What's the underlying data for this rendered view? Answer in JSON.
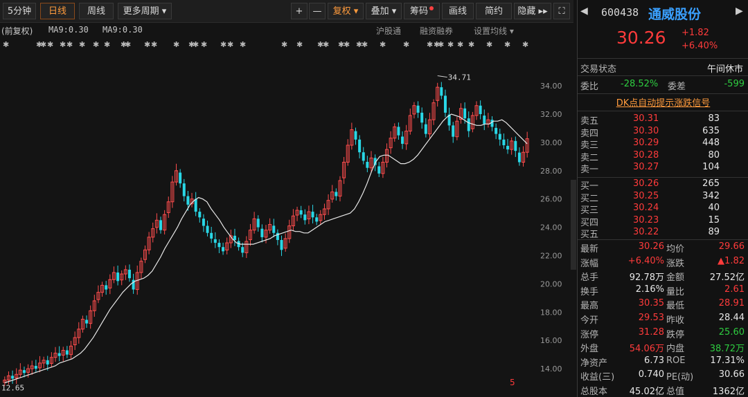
{
  "toolbar": {
    "tabs": [
      "5分钟",
      "日线",
      "周线",
      "更多周期 ▾"
    ],
    "active_tab": "日线",
    "tools": [
      "+",
      "—",
      "复权 ▾",
      "叠加 ▾",
      "筹码",
      "画线",
      "简约",
      "隐藏 ▸▸",
      "⛶"
    ]
  },
  "info": {
    "adjust": "(前复权)",
    "ma1": "MA9:0.30",
    "ma2": "MA9:0.30",
    "link1": "沪股通",
    "link2": "融资融券",
    "link3": "设置均线 ▾"
  },
  "chart_data": {
    "type": "candlestick",
    "ylim": [
      12.0,
      36.4
    ],
    "yticks": [
      "34.00",
      "32.00",
      "30.00",
      "28.00",
      "26.00",
      "24.00",
      "22.00",
      "20.00",
      "18.00",
      "16.00",
      "14.00"
    ],
    "yticks_values": [
      34,
      32,
      30,
      28,
      26,
      24,
      22,
      20,
      18,
      16,
      14
    ],
    "high_label": "34.71",
    "low_label": "12.65",
    "marker": "5",
    "up_color": "#ff4d4d",
    "down_color": "#29d7e6",
    "ma_color": "#e8e8e8",
    "closes": [
      13.2,
      13.5,
      13.3,
      13.6,
      13.9,
      13.7,
      14.0,
      14.2,
      14.0,
      14.4,
      14.6,
      14.3,
      14.8,
      15.1,
      14.9,
      15.3,
      15.0,
      15.6,
      16.2,
      16.8,
      17.5,
      17.2,
      18.1,
      18.8,
      19.4,
      19.9,
      19.6,
      20.3,
      20.8,
      20.2,
      20.7,
      21.0,
      20.4,
      19.6,
      20.8,
      21.6,
      22.4,
      23.3,
      23.9,
      24.5,
      23.8,
      24.9,
      25.8,
      27.2,
      28.0,
      27.1,
      26.2,
      25.6,
      26.0,
      25.1,
      24.7,
      24.1,
      23.6,
      23.2,
      22.9,
      22.6,
      22.3,
      22.9,
      23.4,
      23.1,
      22.6,
      22.2,
      23.0,
      23.8,
      24.6,
      24.0,
      23.3,
      23.8,
      24.2,
      23.6,
      23.1,
      22.4,
      23.2,
      24.1,
      24.8,
      25.2,
      24.9,
      24.5,
      25.1,
      24.7,
      24.4,
      24.9,
      25.3,
      25.9,
      26.5,
      26.2,
      27.3,
      28.6,
      29.8,
      30.9,
      30.2,
      29.3,
      28.7,
      28.2,
      28.9,
      28.4,
      27.8,
      28.6,
      29.5,
      30.3,
      31.1,
      30.5,
      29.9,
      30.8,
      31.9,
      32.6,
      32.1,
      31.4,
      30.6,
      31.6,
      32.8,
      33.9,
      33.3,
      32.1,
      31.2,
      30.4,
      31.5,
      32.4,
      31.7,
      30.8,
      31.9,
      32.6,
      32.0,
      31.3,
      31.6,
      31.1,
      30.6,
      30.2,
      29.8,
      29.5,
      30.1,
      29.4,
      28.6,
      29.3,
      30.26
    ],
    "ma": [
      13.0,
      13.1,
      13.2,
      13.3,
      13.4,
      13.5,
      13.6,
      13.7,
      13.8,
      13.9,
      14.0,
      14.1,
      14.2,
      14.4,
      14.5,
      14.6,
      14.7,
      14.9,
      15.1,
      15.4,
      15.8,
      16.2,
      16.7,
      17.2,
      17.7,
      18.2,
      18.6,
      19.0,
      19.4,
      19.7,
      20.0,
      20.2,
      20.3,
      20.4,
      20.6,
      20.9,
      21.4,
      21.9,
      22.5,
      23.0,
      23.5,
      24.0,
      24.6,
      25.1,
      25.6,
      25.9,
      26.1,
      26.0,
      25.8,
      25.3,
      24.9,
      24.5,
      24.0,
      23.6,
      23.2,
      22.9,
      22.8,
      22.8,
      22.8,
      22.8,
      22.9,
      23.0,
      23.1,
      23.2,
      23.4,
      23.5,
      23.6,
      23.7,
      23.8,
      23.7,
      23.7,
      23.6,
      23.6,
      23.8,
      24.0,
      24.2,
      24.4,
      24.5,
      24.6,
      24.7,
      24.8,
      24.9,
      25.0,
      25.3,
      25.8,
      26.4,
      27.1,
      27.9,
      28.6,
      29.0,
      29.1,
      29.1,
      28.9,
      28.7,
      28.5,
      28.5,
      28.6,
      28.8,
      29.1,
      29.5,
      29.9,
      30.3,
      30.7,
      31.1,
      31.5,
      31.8,
      32.0,
      31.9,
      31.8,
      31.6,
      31.4,
      31.3,
      31.2,
      31.2,
      31.3,
      31.3,
      31.5,
      31.5,
      31.6,
      31.4,
      31.1,
      30.8,
      30.5,
      30.2,
      29.9
    ]
  },
  "panel": {
    "code": "600438",
    "name": "通威股份",
    "price": "30.26",
    "change": "+1.82",
    "change_pct": "+6.40%",
    "status_label": "交易状态",
    "status_value": "午间休市",
    "wb_label": "委比",
    "wb_value": "-28.52%",
    "wc_label": "委差",
    "wc_value": "-599",
    "banner": "DK点自动提示涨跌信号",
    "asks": [
      {
        "label": "卖五",
        "price": "30.31",
        "vol": "83"
      },
      {
        "label": "卖四",
        "price": "30.30",
        "vol": "635"
      },
      {
        "label": "卖三",
        "price": "30.29",
        "vol": "448"
      },
      {
        "label": "卖二",
        "price": "30.28",
        "vol": "80"
      },
      {
        "label": "卖一",
        "price": "30.27",
        "vol": "104"
      }
    ],
    "bids": [
      {
        "label": "买一",
        "price": "30.26",
        "vol": "265"
      },
      {
        "label": "买二",
        "price": "30.25",
        "vol": "342"
      },
      {
        "label": "买三",
        "price": "30.24",
        "vol": "40"
      },
      {
        "label": "买四",
        "price": "30.23",
        "vol": "15"
      },
      {
        "label": "买五",
        "price": "30.22",
        "vol": "89"
      }
    ],
    "stats": [
      {
        "l1": "最新",
        "v1": "30.26",
        "c1": "red",
        "l2": "均价",
        "v2": "29.66",
        "c2": "red"
      },
      {
        "l1": "涨幅",
        "v1": "+6.40%",
        "c1": "red",
        "l2": "涨跌",
        "v2": "▲1.82",
        "c2": "red"
      },
      {
        "l1": "总手",
        "v1": "92.78万",
        "c1": "white",
        "l2": "金额",
        "v2": "27.52亿",
        "c2": "white"
      },
      {
        "l1": "换手",
        "v1": "2.16%",
        "c1": "white",
        "l2": "量比",
        "v2": "2.61",
        "c2": "red"
      },
      {
        "l1": "最高",
        "v1": "30.35",
        "c1": "red",
        "l2": "最低",
        "v2": "28.91",
        "c2": "red"
      },
      {
        "l1": "今开",
        "v1": "29.53",
        "c1": "red",
        "l2": "昨收",
        "v2": "28.44",
        "c2": "white"
      },
      {
        "l1": "涨停",
        "v1": "31.28",
        "c1": "red",
        "l2": "跌停",
        "v2": "25.60",
        "c2": "green"
      },
      {
        "l1": "外盘",
        "v1": "54.06万",
        "c1": "red",
        "l2": "内盘",
        "v2": "38.72万",
        "c2": "green"
      },
      {
        "l1": "净资产",
        "v1": "6.73",
        "c1": "white",
        "l2": "ROE",
        "v2": "17.31%",
        "c2": "white"
      },
      {
        "l1": "收益(三)",
        "v1": "0.740",
        "c1": "white",
        "l2": "PE(动)",
        "v2": "30.66",
        "c2": "white"
      },
      {
        "l1": "总股本",
        "v1": "45.02亿",
        "c1": "white",
        "l2": "总值",
        "v2": "1362亿",
        "c2": "white"
      }
    ]
  }
}
